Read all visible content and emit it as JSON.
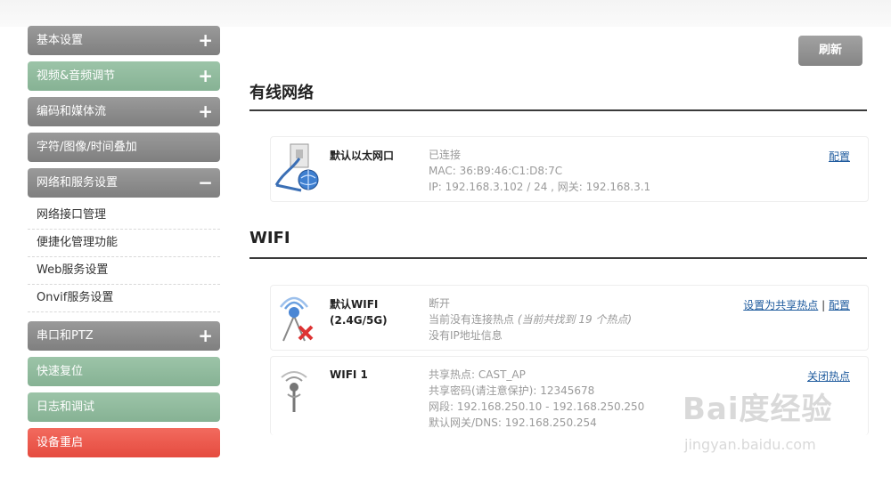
{
  "sidebar": {
    "items": [
      {
        "label": "基本设置",
        "sign": "+"
      },
      {
        "label": "视频&音频调节",
        "sign": "+"
      },
      {
        "label": "编码和媒体流",
        "sign": "+"
      },
      {
        "label": "字符/图像/时间叠加",
        "sign": ""
      },
      {
        "label": "网络和服务设置",
        "sign": "−"
      }
    ],
    "subitems": [
      {
        "label": "网络接口管理"
      },
      {
        "label": "便捷化管理功能"
      },
      {
        "label": "Web服务设置"
      },
      {
        "label": "Onvif服务设置"
      }
    ],
    "bottom_items": [
      {
        "label": "串口和PTZ",
        "sign": "+"
      },
      {
        "label": "快速复位",
        "sign": ""
      },
      {
        "label": "日志和调试",
        "sign": ""
      },
      {
        "label": "设备重启",
        "sign": ""
      }
    ]
  },
  "toolbar": {
    "refresh_label": "刷新"
  },
  "wired": {
    "title": "有线网络",
    "card": {
      "name": "默认以太网口",
      "status": "已连接",
      "mac": "MAC: 36:B9:46:C1:D8:7C",
      "ip": "IP: 192.168.3.102 / 24 , 网关: 192.168.3.1",
      "action": "配置"
    }
  },
  "wifi": {
    "title": "WIFI",
    "card1": {
      "name_line1": "默认WIFI",
      "name_line2": "(2.4G/5G)",
      "status": "断开",
      "hotspot_text": "当前没有连接热点",
      "hotspot_found": "(当前共找到 19 个热点)",
      "ip": "没有IP地址信息",
      "action1": "设置为共享热点",
      "sep": "|",
      "action2": "配置"
    },
    "card2": {
      "name": "WIFI 1",
      "line1": "共享热点: CAST_AP",
      "line2": "共享密码(请注意保护): 12345678",
      "line3": "网段: 192.168.250.10 - 192.168.250.250",
      "line4": "默认网关/DNS: 192.168.250.254",
      "action": "关闭热点"
    }
  },
  "watermark": {
    "brand": "Bai度经验",
    "url": "jingyan.baidu.com"
  },
  "colors": {
    "grey_btn": "#8c8c8c",
    "green_btn": "#92bb9e",
    "red_btn": "#ea5548",
    "link": "#1f5b9e"
  }
}
